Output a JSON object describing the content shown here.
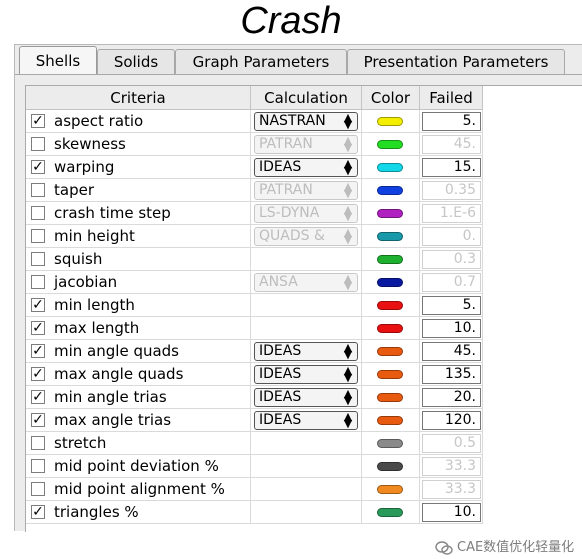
{
  "title": "Crash",
  "tabs": [
    "Shells",
    "Solids",
    "Graph Parameters",
    "Presentation Parameters"
  ],
  "active_tab": "Shells",
  "columns": {
    "criteria": "Criteria",
    "calculation": "Calculation",
    "color": "Color",
    "failed": "Failed"
  },
  "rows": [
    {
      "checked": true,
      "label": "aspect ratio",
      "calc": "NASTRAN",
      "calc_enabled": true,
      "color": "#f4ef00",
      "failed": "5.",
      "failed_enabled": true
    },
    {
      "checked": false,
      "label": "skewness",
      "calc": "PATRAN",
      "calc_enabled": false,
      "color": "#22dd22",
      "failed": "45.",
      "failed_enabled": false
    },
    {
      "checked": true,
      "label": "warping",
      "calc": "IDEAS",
      "calc_enabled": true,
      "color": "#11d8e8",
      "failed": "15.",
      "failed_enabled": true
    },
    {
      "checked": false,
      "label": "taper",
      "calc": "PATRAN",
      "calc_enabled": false,
      "color": "#1040e0",
      "failed": "0.35",
      "failed_enabled": false
    },
    {
      "checked": false,
      "label": "crash time step",
      "calc": "LS-DYNA",
      "calc_enabled": false,
      "color": "#b020c0",
      "failed": "1.E-6",
      "failed_enabled": false
    },
    {
      "checked": false,
      "label": "min height",
      "calc": "QUADS &",
      "calc_enabled": false,
      "color": "#1898a8",
      "failed": "0.",
      "failed_enabled": false
    },
    {
      "checked": false,
      "label": "squish",
      "calc": "",
      "calc_enabled": false,
      "color": "#20b030",
      "failed": "0.3",
      "failed_enabled": false
    },
    {
      "checked": false,
      "label": "jacobian",
      "calc": "ANSA",
      "calc_enabled": false,
      "color": "#0a1aa0",
      "failed": "0.7",
      "failed_enabled": false
    },
    {
      "checked": true,
      "label": "min length",
      "calc": "",
      "calc_enabled": false,
      "color": "#e81010",
      "failed": "5.",
      "failed_enabled": true
    },
    {
      "checked": true,
      "label": "max length",
      "calc": "",
      "calc_enabled": false,
      "color": "#e81010",
      "failed": "10.",
      "failed_enabled": true
    },
    {
      "checked": true,
      "label": "min angle quads",
      "calc": "IDEAS",
      "calc_enabled": true,
      "color": "#e85a10",
      "failed": "45.",
      "failed_enabled": true
    },
    {
      "checked": true,
      "label": "max angle quads",
      "calc": "IDEAS",
      "calc_enabled": true,
      "color": "#e85a10",
      "failed": "135.",
      "failed_enabled": true
    },
    {
      "checked": true,
      "label": "min angle trias",
      "calc": "IDEAS",
      "calc_enabled": true,
      "color": "#e85a10",
      "failed": "20.",
      "failed_enabled": true
    },
    {
      "checked": true,
      "label": "max angle trias",
      "calc": "IDEAS",
      "calc_enabled": true,
      "color": "#e85a10",
      "failed": "120.",
      "failed_enabled": true
    },
    {
      "checked": false,
      "label": "stretch",
      "calc": "",
      "calc_enabled": false,
      "color": "#8a8a8a",
      "failed": "0.5",
      "failed_enabled": false
    },
    {
      "checked": false,
      "label": "mid point deviation %",
      "calc": "",
      "calc_enabled": false,
      "color": "#4a4a4a",
      "failed": "33.3",
      "failed_enabled": false
    },
    {
      "checked": false,
      "label": "mid point alignment %",
      "calc": "",
      "calc_enabled": false,
      "color": "#f08a20",
      "failed": "33.3",
      "failed_enabled": false
    },
    {
      "checked": true,
      "label": "triangles %",
      "calc": "",
      "calc_enabled": false,
      "color": "#2a9a5a",
      "failed": "10.",
      "failed_enabled": true
    }
  ],
  "watermark": "CAE数值优化轻量化"
}
